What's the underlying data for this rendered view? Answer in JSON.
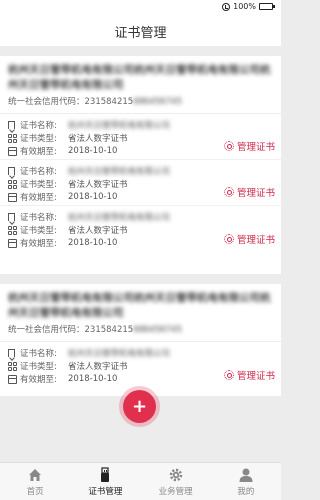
{
  "status": {
    "battery_text": "100%"
  },
  "nav": {
    "title": "证书管理"
  },
  "cards": [
    {
      "company": "杭州天日管带机电有限公司杭州天日管带机电有限公司杭州天日管带机电有限公司",
      "credit_label": "统一社会信用代码：",
      "credit_value": "231584215",
      "credit_masked": "686456745",
      "certs": [
        {
          "name_label": "证书名称:",
          "name_value": "杭州天日管带机电有限公司",
          "type_label": "证书类型:",
          "type_value": "省法人数字证书",
          "expire_label": "有效期至:",
          "expire_value": "2018-10-10",
          "manage_label": "管理证书"
        },
        {
          "name_label": "证书名称:",
          "name_value": "杭州天日管带机电有限公司",
          "type_label": "证书类型:",
          "type_value": "省法人数字证书",
          "expire_label": "有效期至:",
          "expire_value": "2018-10-10",
          "manage_label": "管理证书"
        },
        {
          "name_label": "证书名称:",
          "name_value": "杭州天日管带机电有限公司",
          "type_label": "证书类型:",
          "type_value": "省法人数字证书",
          "expire_label": "有效期至:",
          "expire_value": "2018-10-10",
          "manage_label": "管理证书"
        }
      ]
    },
    {
      "company": "杭州天日管带机电有限公司杭州天日管带机电有限公司杭州天日管带机电有限公司",
      "credit_label": "统一社会信用代码：",
      "credit_value": "231584215",
      "credit_masked": "686456745",
      "certs": [
        {
          "name_label": "证书名称:",
          "name_value": "杭州天日管带机电有限公司",
          "type_label": "证书类型:",
          "type_value": "省法人数字证书",
          "expire_label": "有效期至:",
          "expire_value": "2018-10-10",
          "manage_label": "管理证书"
        }
      ]
    }
  ],
  "fab": {
    "label": "+"
  },
  "tabs": [
    {
      "label": "首页",
      "icon": "home-icon"
    },
    {
      "label": "证书管理",
      "icon": "usb-key-icon"
    },
    {
      "label": "业务管理",
      "icon": "gear-icon"
    },
    {
      "label": "我的",
      "icon": "person-icon"
    }
  ],
  "colors": {
    "accent": "#e0304e",
    "background": "#ececec"
  }
}
